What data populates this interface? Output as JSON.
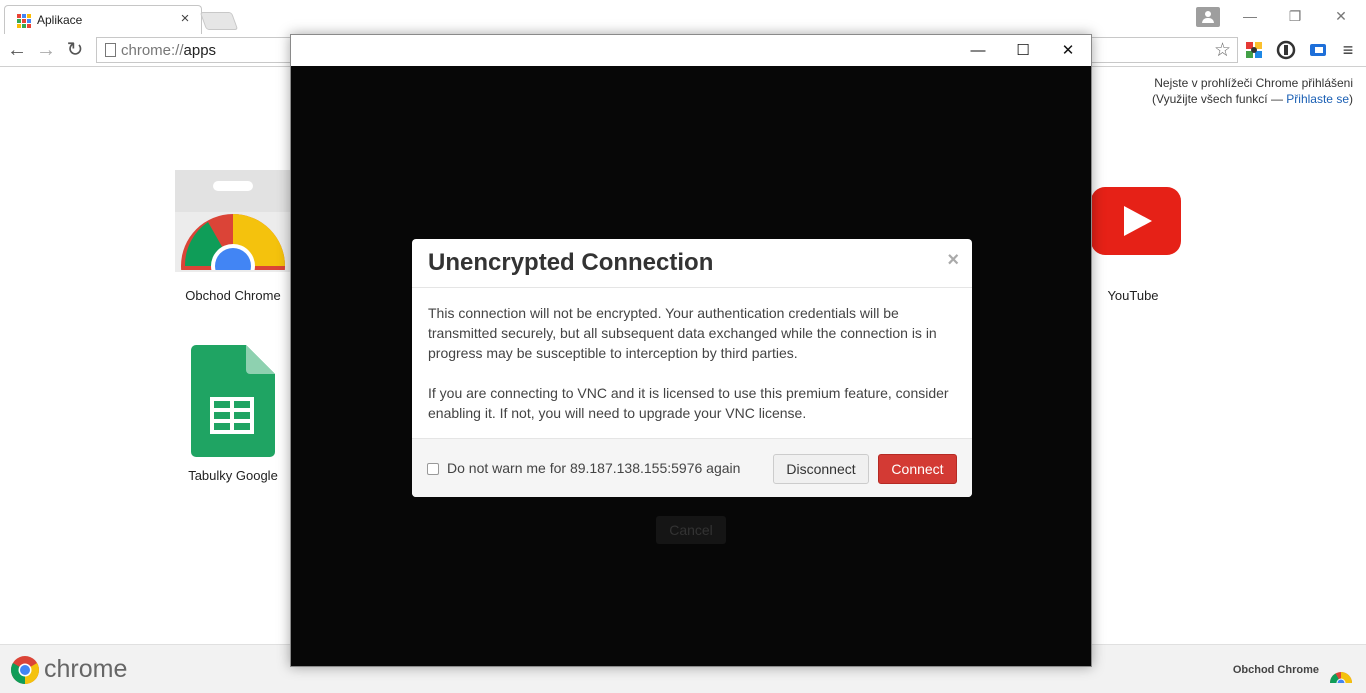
{
  "browser": {
    "tab_title": "Aplikace",
    "tab_close": "×",
    "url_scheme": "chrome://",
    "url_path": "apps",
    "window_controls": {
      "minimize": "—",
      "restore": "❐",
      "close": "✕"
    }
  },
  "nav": {
    "back": "←",
    "forward": "→",
    "reload": "↻"
  },
  "signin": {
    "line1": "Nejste v prohlížeči Chrome přihlášeni",
    "line2_prefix": "(Využijte všech funkcí — ",
    "line2_link": "Přihlaste se",
    "line2_suffix": ")"
  },
  "apps": [
    {
      "label": "Obchod Chrome",
      "icon": "chrome-web-store-icon"
    },
    {
      "label": "Tabulky Google",
      "icon": "google-sheets-icon"
    },
    {
      "label": "YouTube",
      "icon": "youtube-icon"
    }
  ],
  "bottom": {
    "brand": "chrome",
    "store_link": "Obchod Chrome"
  },
  "vnc": {
    "controls": {
      "minimize": "—",
      "maximize": "☐",
      "close": "✕"
    },
    "cancel_label": "Cancel",
    "modal": {
      "title": "Unencrypted Connection",
      "close": "×",
      "para1": "This connection will not be encrypted. Your authentication credentials will be transmitted securely, but all subsequent data exchanged while the connection is in progress may be susceptible to interception by third parties.",
      "para2": "If you are connecting to VNC and it is licensed to use this premium feature, consider enabling it. If not, you will need to upgrade your VNC license.",
      "checkbox_label": "Do not warn me for 89.187.138.155:5976 again",
      "disconnect_label": "Disconnect",
      "connect_label": "Connect"
    }
  },
  "colors": {
    "connect": "#d33a34",
    "youtube": "#e62117",
    "sheets": "#1fa463",
    "link": "#1a5fb4"
  }
}
